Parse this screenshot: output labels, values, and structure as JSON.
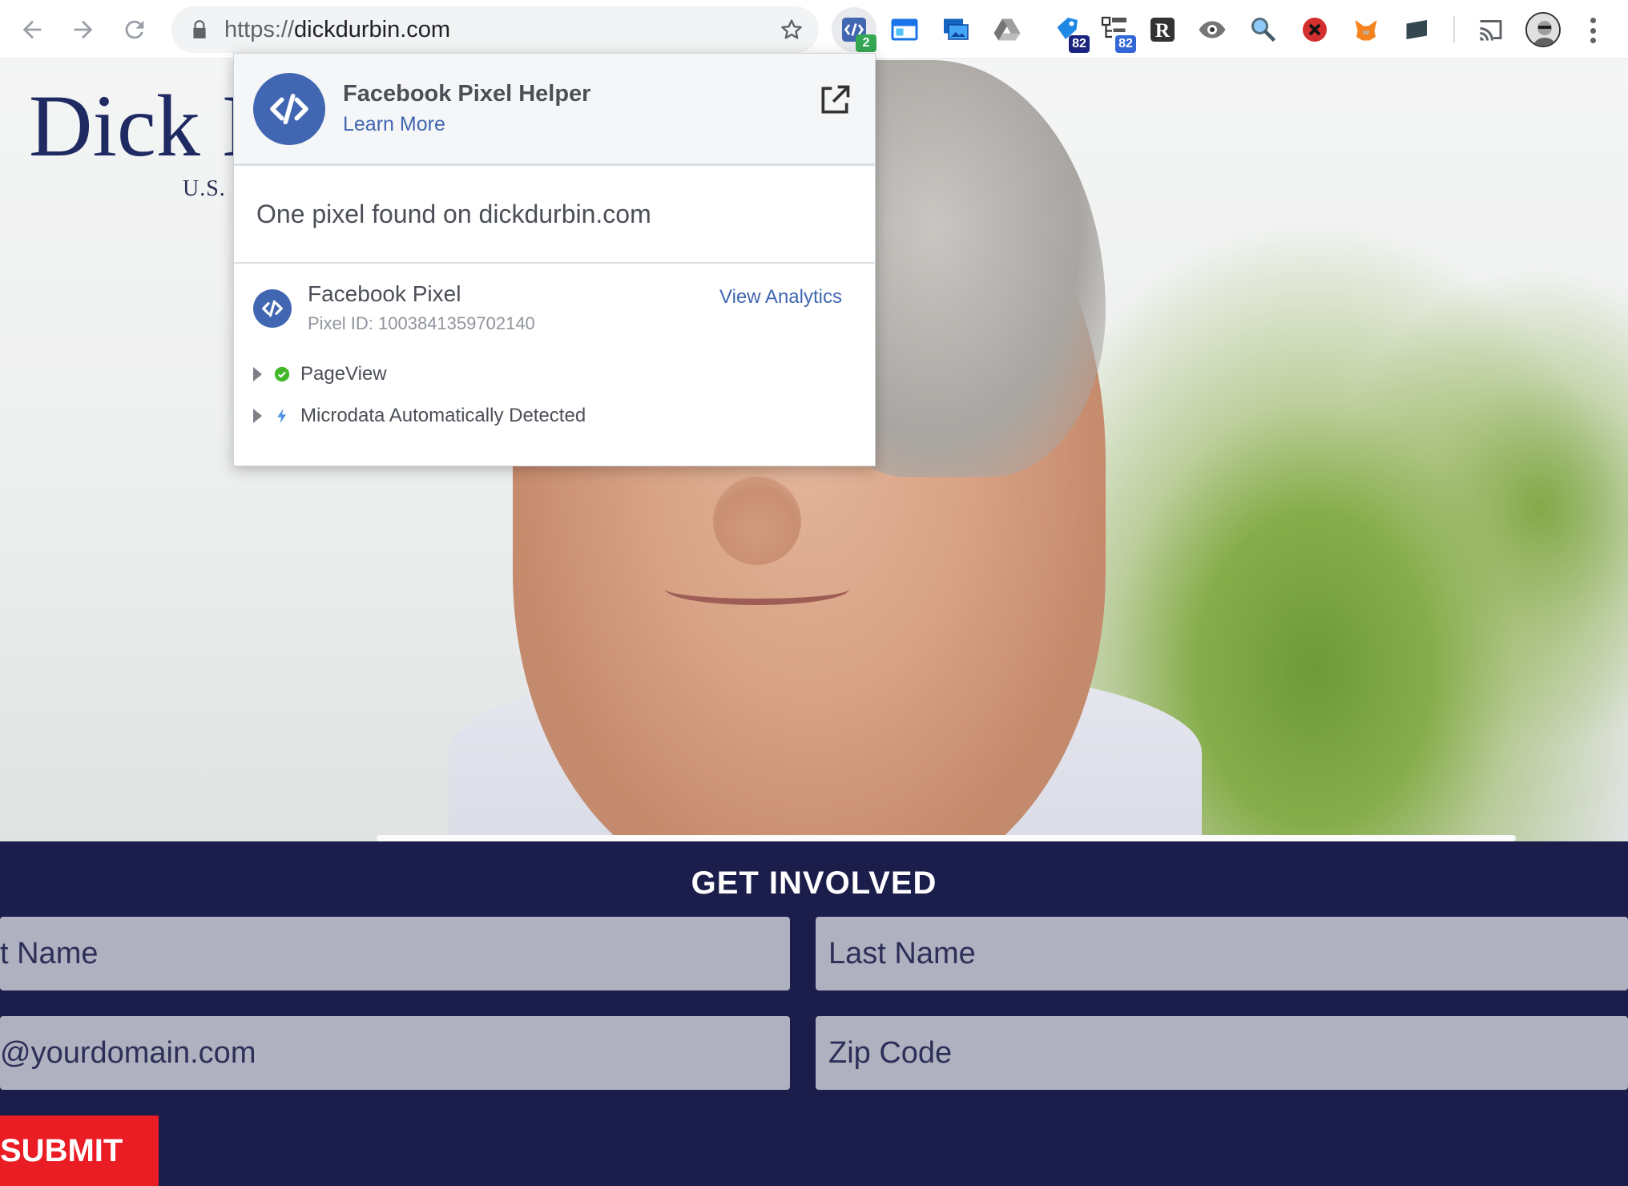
{
  "browser": {
    "url_scheme": "https://",
    "url_host": "dickdurbin.com",
    "extensions": [
      {
        "name": "facebook-pixel-helper",
        "badge": "2",
        "badge_color": "#34a853"
      },
      {
        "name": "window-extension",
        "badge": ""
      },
      {
        "name": "screenshot-extension",
        "badge": ""
      },
      {
        "name": "google-drive",
        "badge": ""
      },
      {
        "name": "tag-assistant",
        "badge": "82",
        "badge_color": "#1a237e"
      },
      {
        "name": "tag-manager",
        "badge": "82",
        "badge_color": "#3367d6"
      },
      {
        "name": "r-extension",
        "badge": ""
      },
      {
        "name": "eye-extension",
        "badge": ""
      },
      {
        "name": "magnifier-extension",
        "badge": ""
      },
      {
        "name": "blocker-extension",
        "badge": ""
      },
      {
        "name": "metamask-fox",
        "badge": ""
      },
      {
        "name": "screen-extension",
        "badge": ""
      }
    ]
  },
  "popup": {
    "app_title": "Facebook Pixel Helper",
    "learn_more": "Learn More",
    "found_text": "One pixel found on dickdurbin.com",
    "pixel_name": "Facebook Pixel",
    "pixel_id": "Pixel ID: 1003841359702140",
    "view_analytics": "View Analytics",
    "events": [
      {
        "label": "PageView",
        "status": "success",
        "icon": "check-circle-icon"
      },
      {
        "label": "Microdata Automatically Detected",
        "status": "info",
        "icon": "lightning-icon"
      }
    ],
    "accent_color": "#4267b2"
  },
  "page": {
    "brand": "Dick D",
    "brand_sub": "U.S. S",
    "form_title": "GET INVOLVED",
    "fields": {
      "first_name": "t Name",
      "last_name": "Last Name",
      "email": "@yourdomain.com",
      "zip": "Zip Code"
    },
    "submit_label": "SUBMIT",
    "form_bg_color": "#1b1d4a",
    "submit_color": "#ea1c24"
  }
}
